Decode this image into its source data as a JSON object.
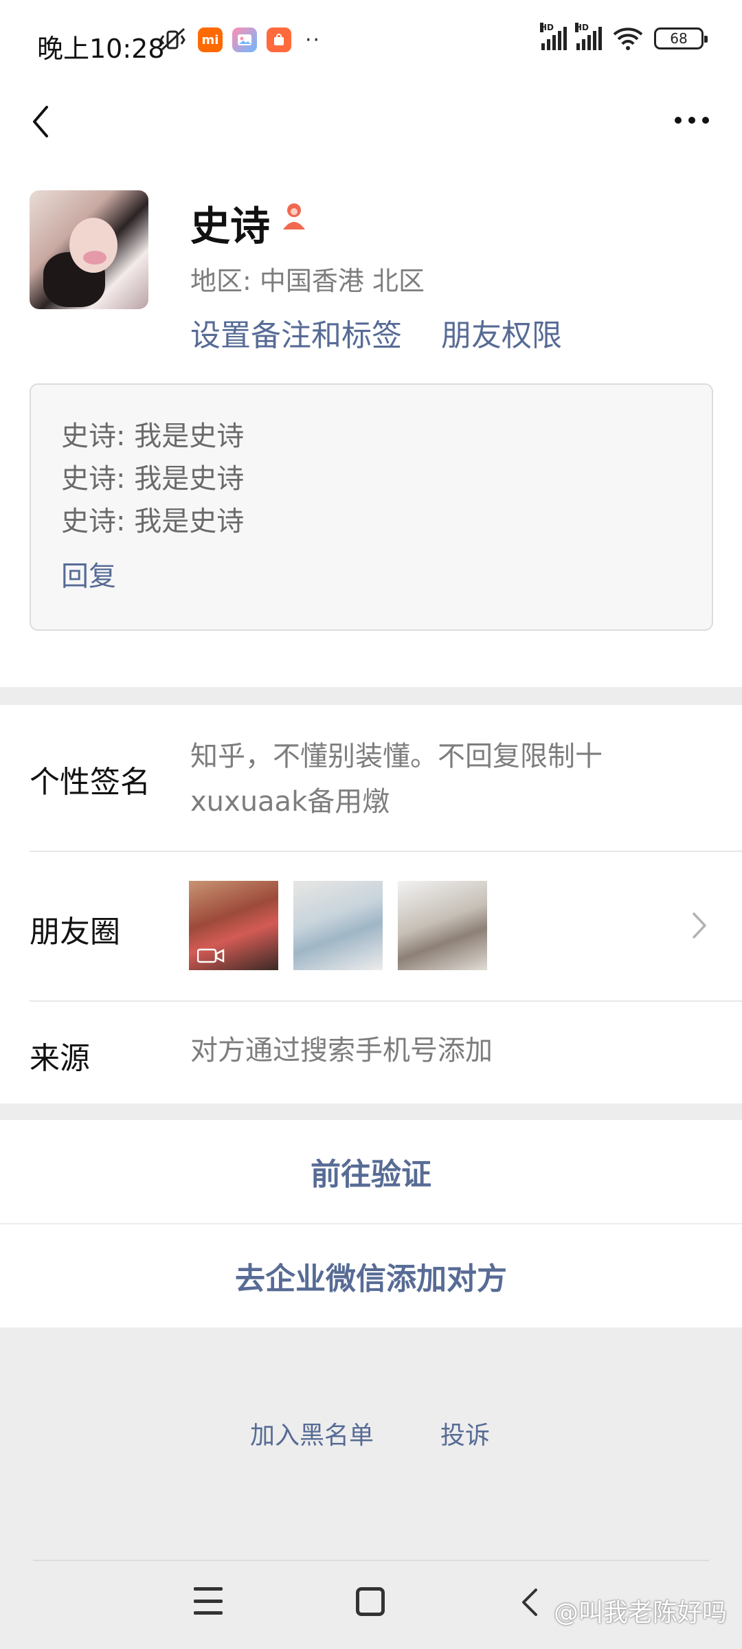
{
  "status_bar": {
    "time": "晚上10:28",
    "battery": "68",
    "apps": [
      {
        "name": "mi-app-icon",
        "label": "mi",
        "color": "#ff6a00"
      },
      {
        "name": "gallery-app-icon",
        "label": "",
        "color": "#ff8fb1"
      },
      {
        "name": "shop-app-icon",
        "label": "",
        "color": "#ff6a3d"
      }
    ],
    "more": "··",
    "signal_label": "HD"
  },
  "profile": {
    "name": "史诗",
    "region": "地区:  中国香港  北区",
    "set_remark_label": "设置备注和标签",
    "friend_permission_label": "朋友权限",
    "messages": [
      "史诗: 我是史诗",
      "史诗: 我是史诗",
      "史诗: 我是史诗"
    ],
    "reply_label": "回复"
  },
  "info": {
    "signature_label": "个性签名",
    "signature_lines": [
      "知乎，不懂别装懂。不回复限制十",
      "xuxuaak备用燉"
    ],
    "moments_label": "朋友圈",
    "source_label": "来源",
    "source_value": "对方通过搜索手机号添加"
  },
  "actions": {
    "verify": "前往验证",
    "wecom_add": "去企业微信添加对方",
    "blacklist": "加入黑名单",
    "report": "投诉"
  },
  "watermark": "@叫我老陈好吗",
  "colors": {
    "link": "#576b95",
    "background": "#ededed",
    "badge": "#f0694f"
  }
}
